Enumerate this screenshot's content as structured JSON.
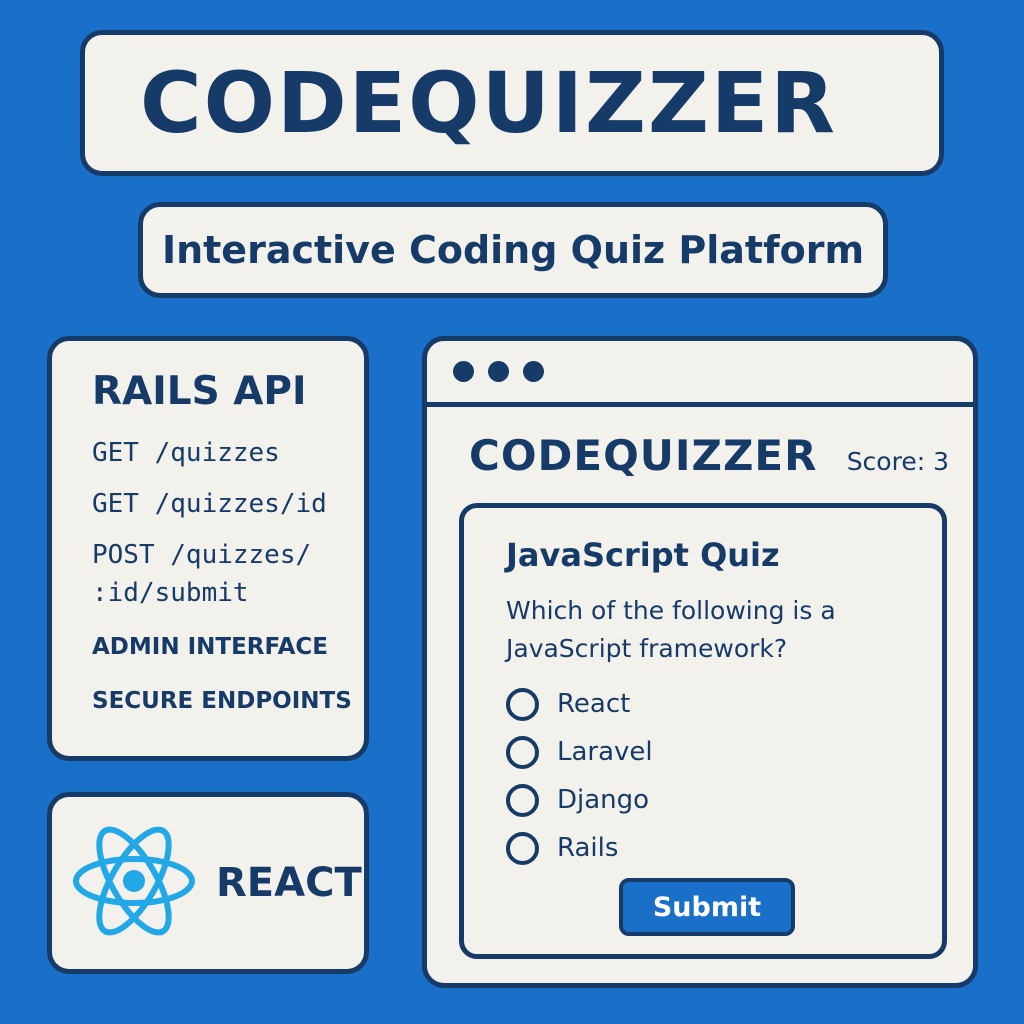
{
  "header": {
    "title": "CODEQUIZZER",
    "subtitle": "Interactive Coding Quiz Platform"
  },
  "rails": {
    "heading": "RAILS API",
    "endpoints": [
      "GET /quizzes",
      "GET /quizzes/id",
      "POST /quizzes/",
      ":id/submit"
    ],
    "features": [
      "ADMIN INTERFACE",
      "SECURE ENDPOINTS"
    ]
  },
  "react": {
    "label": "REACT",
    "icon": "react-atom-icon",
    "icon_color": "#22a8e6"
  },
  "app": {
    "name": "CODEQUIZZER",
    "score_label": "Score:",
    "score_value": "3",
    "quiz": {
      "title": "JavaScript Quiz",
      "question": "Which of the following is a JavaScript framework?",
      "options": [
        "React",
        "Laravel",
        "Django",
        "Rails"
      ],
      "submit_label": "Submit"
    }
  },
  "colors": {
    "background": "#1a6fc9",
    "panel": "#f2f1ec",
    "ink": "#173b68",
    "button": "#1a6fc9"
  }
}
